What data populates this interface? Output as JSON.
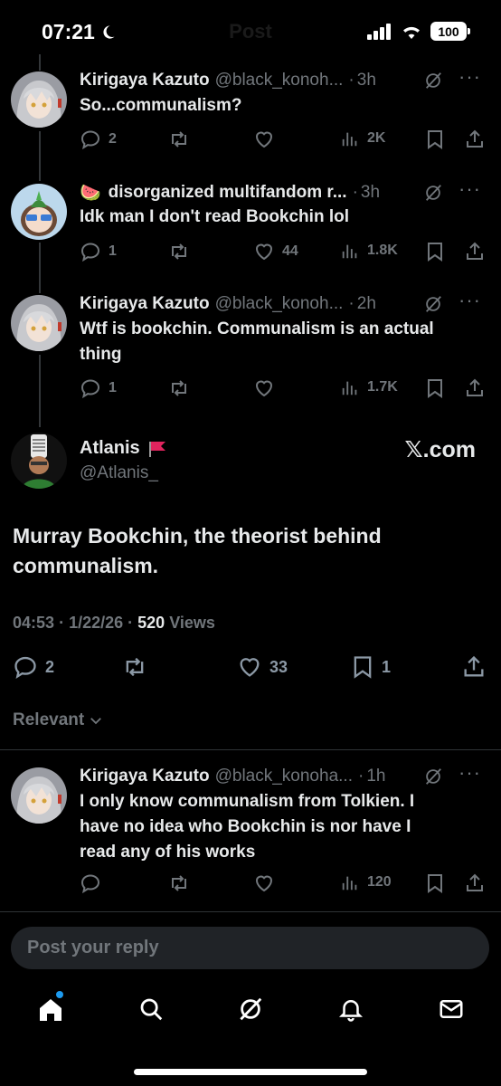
{
  "status_bar": {
    "time": "07:21",
    "battery": "100",
    "title": "Post"
  },
  "thread": [
    {
      "name": "Kirigaya Kazuto",
      "handle": "@black_konoh...",
      "time": "3h",
      "text": [
        "So...communalism?"
      ],
      "replies": "2",
      "reposts": "",
      "likes": "",
      "views": "2K"
    },
    {
      "emoji": "🍉",
      "name": "disorganized multifandom r...",
      "handle": "",
      "time": "3h",
      "text": [
        "Idk man I don't read Bookchin lol"
      ],
      "replies": "1",
      "reposts": "",
      "likes": "44",
      "views": "1.8K"
    },
    {
      "name": "Kirigaya Kazuto",
      "handle": "@black_konoh...",
      "time": "2h",
      "text": [
        "Wtf is bookchin. Communalism is an actual",
        "thing"
      ],
      "replies": "1",
      "reposts": "",
      "likes": "",
      "views": "1.7K"
    }
  ],
  "main_post": {
    "name": "Atlanis",
    "handle": "@Atlanis_",
    "source": "𝕏.com",
    "text": [
      "Murray Bookchin, the theorist behind",
      "communalism."
    ],
    "time": "04:53",
    "date": "1/22/26",
    "views_count": "520",
    "views_label": "Views",
    "replies": "2",
    "likes": "33",
    "bookmarks": "1"
  },
  "sort_label": "Relevant",
  "reply": {
    "name": "Kirigaya Kazuto",
    "handle": "@black_konoha...",
    "time": "1h",
    "text": [
      "I only know communalism from Tolkien. I",
      "have no idea who Bookchin is nor have I",
      "read any of his works"
    ],
    "views": "120"
  },
  "composer_placeholder": "Post your reply",
  "colors": {
    "accent": "#1d9bf0",
    "muted": "#71767b",
    "flag": "#e0245e"
  }
}
